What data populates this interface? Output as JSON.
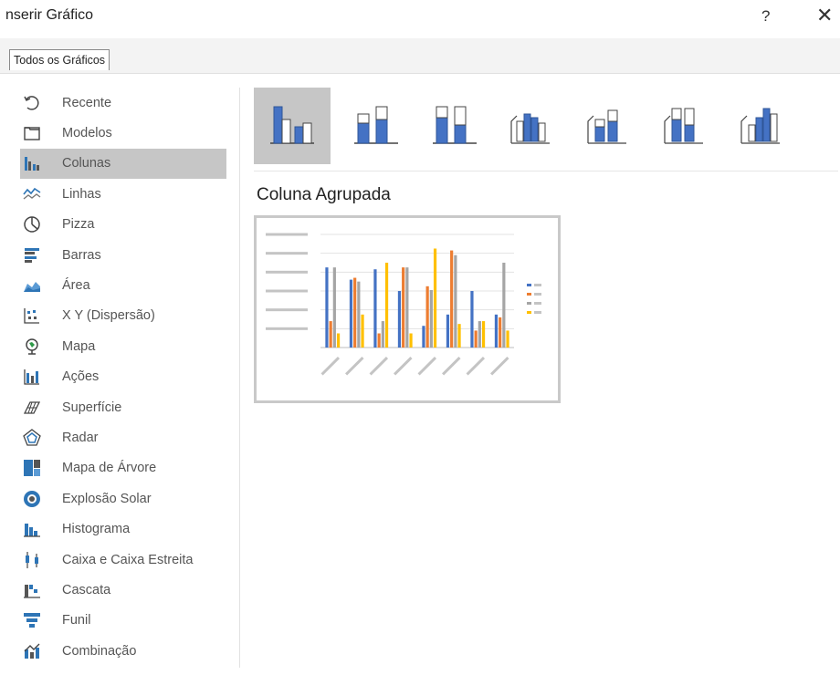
{
  "window": {
    "title": "nserir Gráfico",
    "help_label": "?",
    "close_label": "✕"
  },
  "tabs": [
    {
      "label": "Todos os Gráficos"
    }
  ],
  "sidebar": {
    "items": [
      {
        "label": "Recente",
        "icon": "recent-icon"
      },
      {
        "label": "Modelos",
        "icon": "folder-icon"
      },
      {
        "label": "Colunas",
        "icon": "column-chart-icon"
      },
      {
        "label": "Linhas",
        "icon": "line-chart-icon"
      },
      {
        "label": "Pizza",
        "icon": "pie-chart-icon"
      },
      {
        "label": "Barras",
        "icon": "bar-chart-icon"
      },
      {
        "label": "Área",
        "icon": "area-chart-icon"
      },
      {
        "label": "X Y (Dispersão)",
        "icon": "scatter-chart-icon"
      },
      {
        "label": "Mapa",
        "icon": "map-chart-icon"
      },
      {
        "label": "Ações",
        "icon": "stock-chart-icon"
      },
      {
        "label": "Superfície",
        "icon": "surface-chart-icon"
      },
      {
        "label": "Radar",
        "icon": "radar-chart-icon"
      },
      {
        "label": "Mapa de Árvore",
        "icon": "treemap-icon"
      },
      {
        "label": "Explosão Solar",
        "icon": "sunburst-icon"
      },
      {
        "label": "Histograma",
        "icon": "histogram-icon"
      },
      {
        "label": "Caixa e Caixa Estreita",
        "icon": "box-whisker-icon"
      },
      {
        "label": "Cascata",
        "icon": "waterfall-icon"
      },
      {
        "label": "Funil",
        "icon": "funnel-icon"
      },
      {
        "label": "Combinação",
        "icon": "combo-chart-icon"
      }
    ],
    "selected": "Colunas"
  },
  "subtypes": {
    "items": [
      {
        "icon": "clustered-column-icon"
      },
      {
        "icon": "stacked-column-icon"
      },
      {
        "icon": "100-stacked-column-icon"
      },
      {
        "icon": "3d-clustered-column-icon"
      },
      {
        "icon": "3d-stacked-column-icon"
      },
      {
        "icon": "3d-100-stacked-column-icon"
      },
      {
        "icon": "3d-column-icon"
      }
    ],
    "selected_name": "Coluna Agrupada"
  },
  "colors": {
    "blue": "#4472c4",
    "orange": "#ed7d31",
    "gray": "#a5a5a5",
    "gold": "#ffc000",
    "selection": "#c6c6c6"
  },
  "chart_data": {
    "type": "bar",
    "ylim": [
      0,
      1200000
    ],
    "grid": true,
    "legend_position": "right",
    "series": [
      {
        "values": [
          850000,
          720000,
          830000,
          600000,
          230000,
          350000,
          600000,
          350000
        ]
      },
      {
        "values": [
          280000,
          740000,
          150000,
          850000,
          650000,
          1030000,
          180000,
          320000
        ]
      },
      {
        "values": [
          850000,
          700000,
          280000,
          850000,
          610000,
          980000,
          280000,
          900000
        ]
      },
      {
        "values": [
          150000,
          350000,
          900000,
          150000,
          1050000,
          250000,
          280000,
          180000
        ]
      }
    ]
  }
}
